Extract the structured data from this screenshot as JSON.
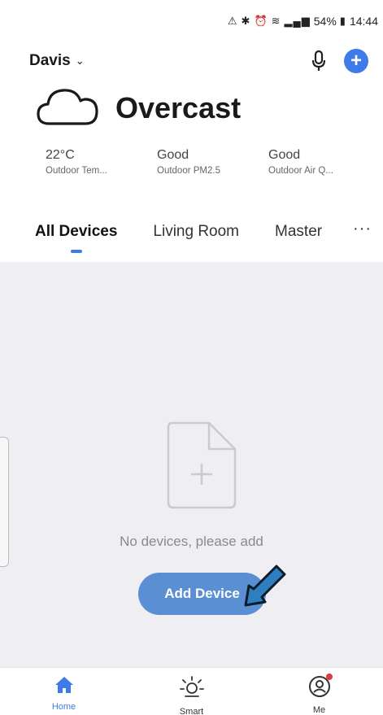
{
  "status_bar": {
    "icons": [
      "triangle-alert-icon",
      "bluetooth-icon",
      "alarm-icon",
      "wifi-icon",
      "signal-icon"
    ],
    "battery": "54%",
    "time": "14:44"
  },
  "header": {
    "home_name": "Davis",
    "accent_color": "#3f7be8"
  },
  "weather": {
    "icon": "cloud-icon",
    "condition": "Overcast",
    "stats": [
      {
        "value": "22°C",
        "label": "Outdoor Tem..."
      },
      {
        "value": "Good",
        "label": "Outdoor PM2.5"
      },
      {
        "value": "Good",
        "label": "Outdoor Air Q..."
      }
    ]
  },
  "tabs": {
    "items": [
      {
        "label": "All Devices",
        "active": true
      },
      {
        "label": "Living Room",
        "active": false
      },
      {
        "label": "Master",
        "active": false
      }
    ],
    "more": "···"
  },
  "empty_state": {
    "icon": "add-document-icon",
    "message": "No devices, please add",
    "button_label": "Add Device",
    "button_color": "#5b8fd4"
  },
  "bottom_nav": {
    "items": [
      {
        "label": "Home",
        "icon": "home-icon",
        "active": true
      },
      {
        "label": "Smart",
        "icon": "sun-icon",
        "active": false
      },
      {
        "label": "Me",
        "icon": "user-icon",
        "active": false,
        "badge": true
      }
    ]
  }
}
